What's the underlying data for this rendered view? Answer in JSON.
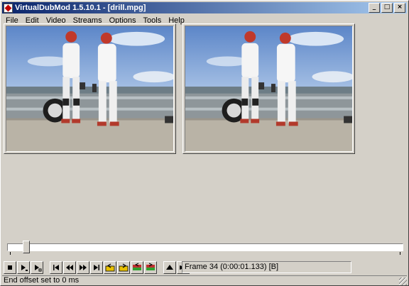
{
  "window": {
    "title": "VirtualDubMod 1.5.10.1 - [drill.mpg]",
    "controls": [
      {
        "name": "minimize-button",
        "glyph": "_"
      },
      {
        "name": "maximize-button",
        "glyph": "□"
      },
      {
        "name": "close-button",
        "glyph": "×"
      }
    ]
  },
  "menu": [
    "File",
    "Edit",
    "Video",
    "Streams",
    "Options",
    "Tools",
    "Help"
  ],
  "panes": {
    "input": {
      "description_icon": "video-frame-image"
    },
    "output": {
      "description_icon": "video-frame-image"
    }
  },
  "position": {
    "current_frame": 34,
    "slider_fraction": 0.04
  },
  "toolbar": {
    "buttons": [
      {
        "name": "stop-button",
        "icon": "stop-icon"
      },
      {
        "name": "play-input-button",
        "icon": "play-input-icon"
      },
      {
        "name": "play-output-button",
        "icon": "play-output-icon"
      },
      {
        "name": "start-button",
        "icon": "skip-start-icon"
      },
      {
        "name": "back-button",
        "icon": "step-back-icon"
      },
      {
        "name": "forward-button",
        "icon": "step-forward-icon"
      },
      {
        "name": "end-button",
        "icon": "skip-end-icon"
      },
      {
        "name": "prev-keyframe-button",
        "icon": "prev-keyframe-icon"
      },
      {
        "name": "next-keyframe-button",
        "icon": "next-keyframe-icon"
      },
      {
        "name": "scene-back-button",
        "icon": "scene-back-icon"
      },
      {
        "name": "scene-forward-button",
        "icon": "scene-forward-icon"
      },
      {
        "name": "mark-in-button",
        "icon": "mark-in-icon"
      },
      {
        "name": "mark-out-button",
        "icon": "mark-out-icon"
      }
    ],
    "frame_info": "Frame 34 (0:00:01.133) [B]"
  },
  "status": "End offset set to 0 ms",
  "colors": {
    "titlebar_start": "#0a246a",
    "titlebar_end": "#a6caf0",
    "face": "#d4d0c8"
  }
}
